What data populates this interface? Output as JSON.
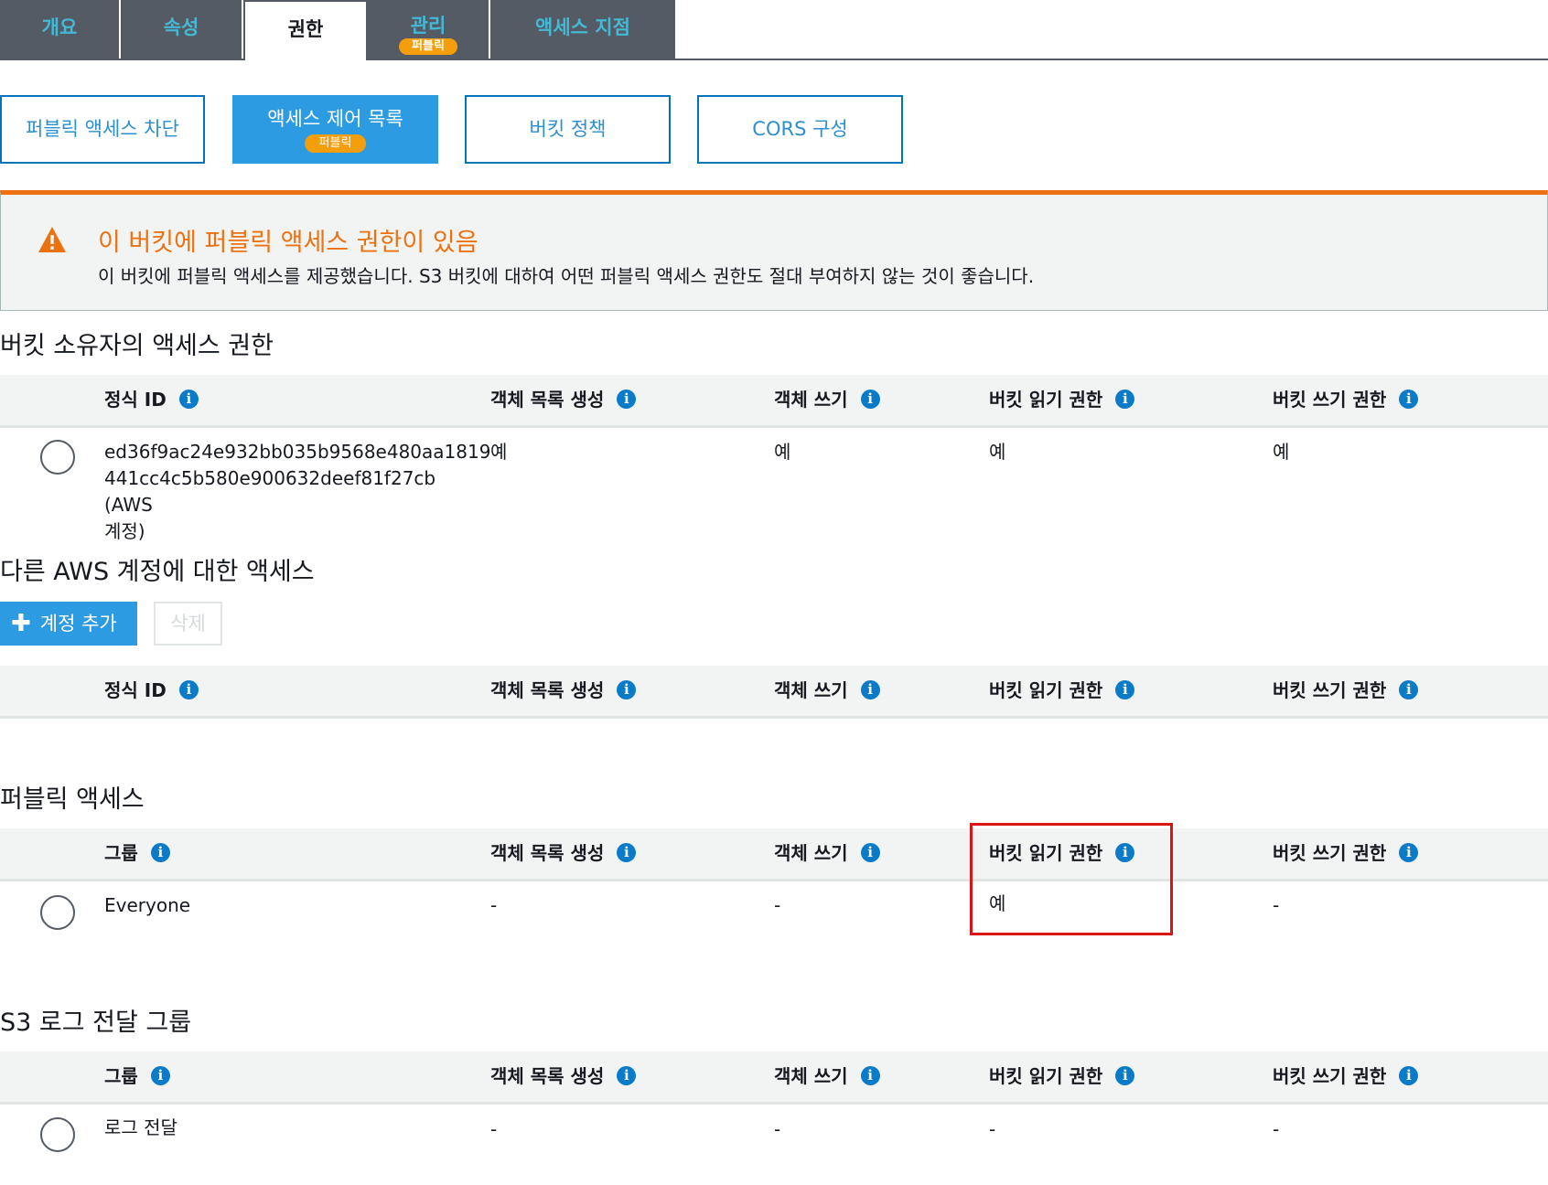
{
  "tabs": [
    {
      "label": "개요"
    },
    {
      "label": "속성"
    },
    {
      "label": "권한"
    },
    {
      "label": "관리",
      "badge": "퍼블릭"
    },
    {
      "label": "액세스 지점"
    }
  ],
  "subtabs": [
    {
      "label": "퍼블릭 액세스 차단"
    },
    {
      "label": "액세스 제어 목록",
      "badge": "퍼블릭"
    },
    {
      "label": "버킷 정책"
    },
    {
      "label": "CORS 구성"
    }
  ],
  "warning": {
    "title": "이 버킷에 퍼블릭 액세스 권한이 있음",
    "text": "이 버킷에 퍼블릭 액세스를 제공했습니다. S3 버킷에 대하여 어떤 퍼블릭 액세스 권한도 절대 부여하지 않는 것이 좋습니다."
  },
  "columns": {
    "canonical_id": "정식 ID",
    "group": "그룹",
    "list_objects": "객체 목록 생성",
    "write_objects": "객체 쓰기",
    "read_bucket_perms": "버킷 읽기 권한",
    "write_bucket_perms": "버킷 쓰기 권한"
  },
  "owner_section": {
    "title": "버킷 소유자의 액세스 권한",
    "row": {
      "id_line1": "ed36f9ac24e932bb035b9568e480aa1819",
      "id_line2": "441cc4c5b580e900632deef81f27cb (AWS",
      "id_line3": "계정)",
      "list_objects": "예",
      "write_objects": "예",
      "read_bucket_perms": "예",
      "write_bucket_perms": "예"
    }
  },
  "other_accounts_section": {
    "title": "다른 AWS 계정에 대한 액세스",
    "add_button": "계정 추가",
    "delete_button": "삭제"
  },
  "public_section": {
    "title": "퍼블릭 액세스",
    "row": {
      "group": "Everyone",
      "list_objects": "-",
      "write_objects": "-",
      "read_bucket_perms": "예",
      "write_bucket_perms": "-"
    }
  },
  "log_section": {
    "title": "S3 로그 전달 그룹",
    "row": {
      "group": "로그 전달",
      "list_objects": "-",
      "write_objects": "-",
      "read_bucket_perms": "-",
      "write_bucket_perms": "-"
    }
  },
  "colors": {
    "tab_bg": "#545b64",
    "tab_text": "#44b9d6",
    "primary": "#2d9be2",
    "badge": "#f59e0b",
    "warning": "#ec7211",
    "highlight": "#d91515"
  },
  "icons": {
    "info": "i",
    "warning": "warning-triangle-icon",
    "plus": "+"
  }
}
